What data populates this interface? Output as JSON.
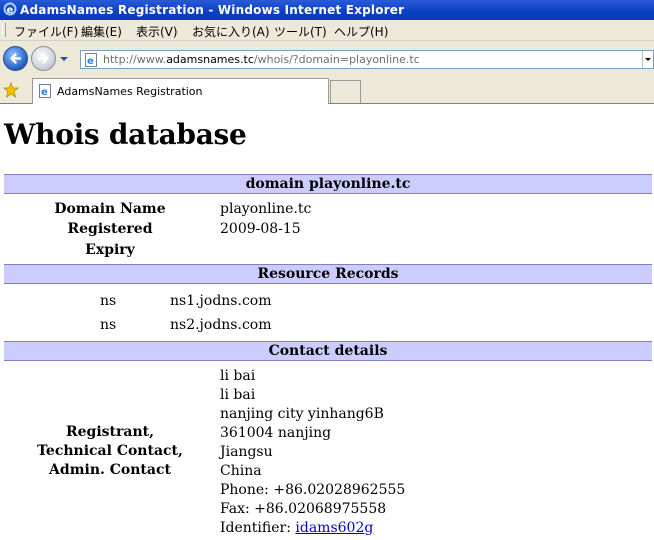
{
  "window": {
    "title": "AdamsNames Registration - Windows Internet Explorer"
  },
  "menu": [
    "ファイル(F)",
    "編集(E)",
    "表示(V)",
    "お気に入り(A)",
    "ツール(T)",
    "ヘルプ(H)"
  ],
  "address": {
    "prefix": "http://www.",
    "host": "adamsnames.tc",
    "path": "/whois/?domain=playonline.tc"
  },
  "tab": {
    "label": "AdamsNames Registration"
  },
  "page": {
    "heading": "Whois database",
    "domain_section": {
      "title": "domain playonline.tc",
      "domain_name_label": "Domain Name",
      "domain_name_value": "playonline.tc",
      "expiry_label_line1": "Registered",
      "expiry_label_line2": "Expiry",
      "expiry_value": "2009-08-15"
    },
    "records_section": {
      "title": "Resource Records",
      "rows": [
        {
          "type": "ns",
          "value": "ns1.jodns.com"
        },
        {
          "type": "ns",
          "value": "ns2.jodns.com"
        }
      ]
    },
    "contact_section": {
      "title": "Contact details",
      "label_lines": [
        "Registrant,",
        "Technical Contact,",
        "Admin. Contact"
      ],
      "lines": [
        "li bai",
        "li bai",
        "nanjing city yinhang6B",
        "361004 nanjing",
        "Jiangsu",
        "China",
        "Phone: +86.02028962555",
        "Fax: +86.02068975558"
      ],
      "identifier_label": "Identifier:",
      "identifier_value": "idams602g"
    }
  }
}
